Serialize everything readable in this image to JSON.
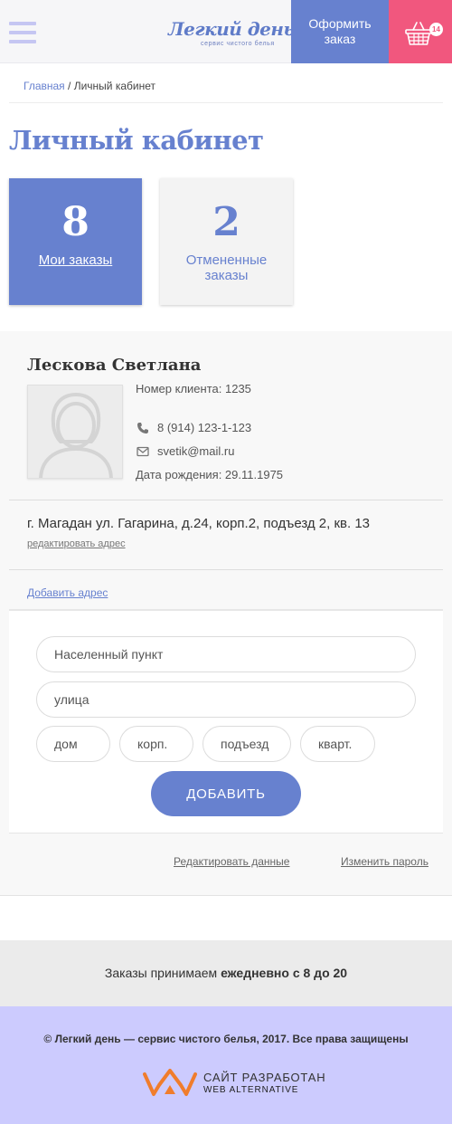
{
  "header": {
    "logo_title": "Легкий день",
    "logo_subtitle": "сервис чистого белья",
    "order_button": "Оформить\nзаказ",
    "cart_count": "14"
  },
  "breadcrumb": {
    "home": "Главная",
    "separator": " / ",
    "current": "Личный кабинет"
  },
  "page_title": "Личный кабинет",
  "stats": {
    "orders": {
      "count": "8",
      "label": "Мои заказы"
    },
    "cancelled": {
      "count": "2",
      "label": "Отмененные заказы"
    }
  },
  "profile": {
    "name": "Лескова Светлана",
    "client_number": "Номер клиента: 1235",
    "phone": "8 (914) 123-1-123",
    "email": "svetik@mail.ru",
    "birth_date": "Дата рождения: 29.11.1975",
    "address": "г. Магадан ул. Гагарина, д.24, корп.2, подъезд 2, кв. 13",
    "edit_address": "редактировать адрес",
    "add_address": "Добавить адрес"
  },
  "address_form": {
    "city_placeholder": "Населенный пункт",
    "street_placeholder": "улица",
    "house_placeholder": "дом",
    "building_placeholder": "корп.",
    "entrance_placeholder": "подъезд",
    "apartment_placeholder": "кварт.",
    "submit_label": "ДОБАВИТЬ"
  },
  "profile_links": {
    "edit_data": "Редактировать данные",
    "change_password": "Изменить пароль"
  },
  "footer": {
    "hours_prefix": "Заказы  принимаем ",
    "hours_bold": "ежедневно с 8 до 20",
    "copyright": "© Легкий день — сервис чистого белья, 2017. Все права защищены",
    "developer_line1": "САЙТ РАЗРАБОТАН",
    "developer_line2": "WEB ALTERNATIVE"
  },
  "colors": {
    "accent_blue": "#6781cf",
    "cart_pink": "#f1577e",
    "footer_lavender": "#cccbfe",
    "dev_logo_orange": "#f07d2c"
  }
}
